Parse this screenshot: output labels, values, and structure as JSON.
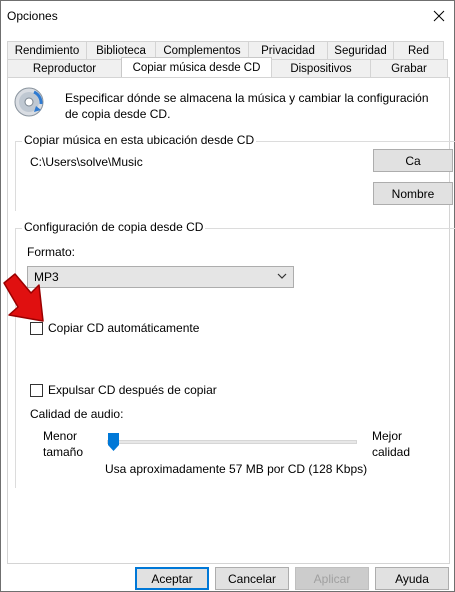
{
  "window": {
    "title": "Opciones"
  },
  "tabs": {
    "back_row": [
      "Rendimiento",
      "Biblioteca",
      "Complementos",
      "Privacidad",
      "Seguridad",
      "Red"
    ],
    "front_row": [
      "Reproductor",
      "Copiar música desde CD",
      "Dispositivos",
      "Grabar"
    ],
    "active": "Copiar música desde CD"
  },
  "header": {
    "description": "Especificar dónde se almacena la música y cambiar la configuración de copia desde CD.",
    "icon": "cd-rip-icon"
  },
  "location_group": {
    "label": "Copiar música en esta ubicación desde CD",
    "path": "C:\\Users\\solve\\Music",
    "change_button": "Ca",
    "rename_button": "Nombre"
  },
  "settings_group": {
    "label": "Configuración de copia desde CD",
    "format_label": "Formato:",
    "format_value": "MP3",
    "auto_copy_label": "Copiar CD automáticamente",
    "auto_copy_checked": false,
    "eject_label": "Expulsar CD después de copiar",
    "eject_checked": false,
    "quality_label": "Calidad de audio:",
    "quality_min_line1": "Menor",
    "quality_min_line2": "tamaño",
    "quality_max_line1": "Mejor",
    "quality_max_line2": "calidad",
    "quality_level": 0,
    "quality_note": "Usa aproximadamente 57 MB por CD (128 Kbps)"
  },
  "footer": {
    "ok": "Aceptar",
    "cancel": "Cancelar",
    "apply": "Aplicar",
    "help": "Ayuda"
  },
  "colors": {
    "focus_blue": "#0078d7",
    "arrow_red": "#e01010"
  }
}
